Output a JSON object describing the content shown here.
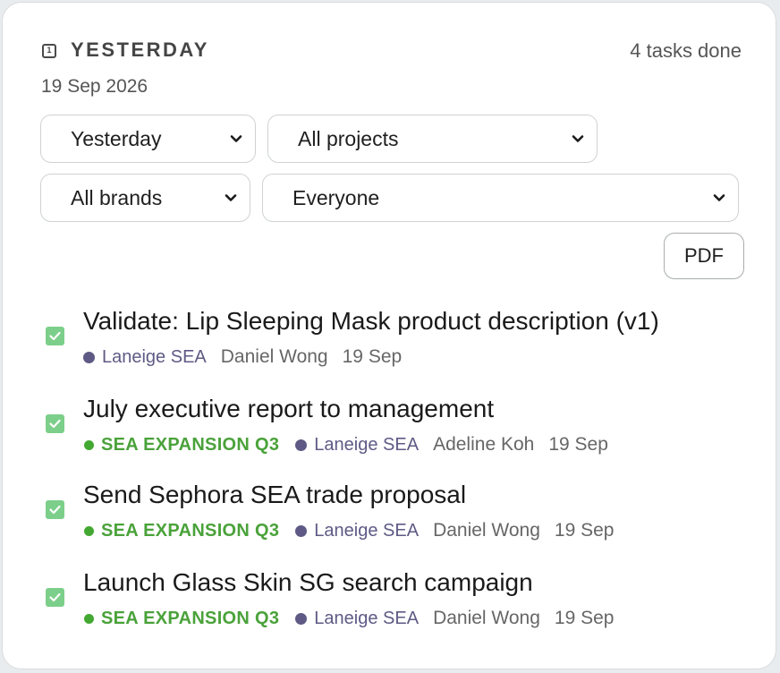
{
  "header": {
    "icon": "calendar-icon",
    "icon_digit": "1",
    "title": "YESTERDAY",
    "count": "4 tasks done",
    "date": "19 Sep 2026"
  },
  "filters": {
    "period": "Yesterday",
    "project": "All projects",
    "brand": "All brands",
    "person": "Everyone"
  },
  "actions": {
    "pdf_label": "PDF"
  },
  "colors": {
    "check": "#7ccf8a",
    "project": "#4aa23a",
    "brand_dot": "#5e5a85"
  },
  "tasks": [
    {
      "title": "Validate: Lip Sleeping Mask product description (v1)",
      "project": "",
      "brand": "Laneige SEA",
      "person": "Daniel Wong",
      "date": "19 Sep"
    },
    {
      "title": "July executive report to management",
      "project": "SEA EXPANSION Q3",
      "brand": "Laneige SEA",
      "person": "Adeline Koh",
      "date": "19 Sep"
    },
    {
      "title": "Send Sephora SEA trade proposal",
      "project": "SEA EXPANSION Q3",
      "brand": "Laneige SEA",
      "person": "Daniel Wong",
      "date": "19 Sep"
    },
    {
      "title": "Launch Glass Skin SG search campaign",
      "project": "SEA EXPANSION Q3",
      "brand": "Laneige SEA",
      "person": "Daniel Wong",
      "date": "19 Sep"
    }
  ]
}
